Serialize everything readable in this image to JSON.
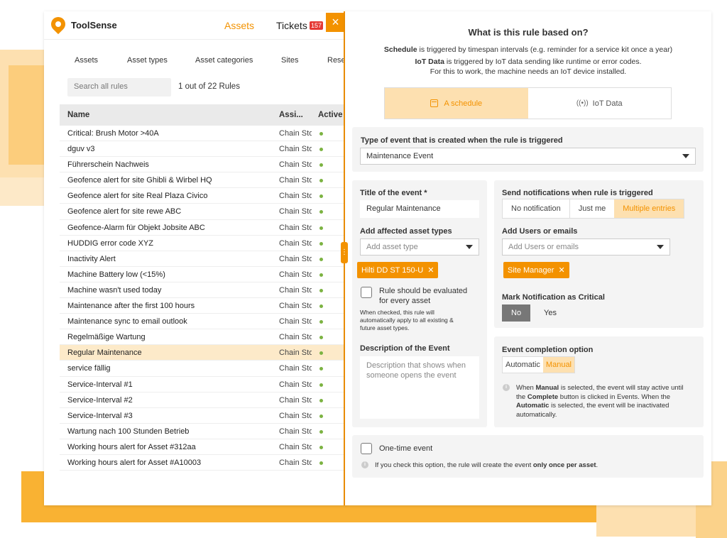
{
  "brand": "ToolSense",
  "nav": {
    "assets": "Assets",
    "tickets": "Tickets",
    "tickets_badge": "157"
  },
  "subnav": [
    "Assets",
    "Asset types",
    "Asset categories",
    "Sites",
    "Rese"
  ],
  "search": {
    "placeholder": "Search all rules",
    "count": "1 out of 22 Rules"
  },
  "table": {
    "headers": [
      "Name",
      "Assi...",
      "Active"
    ],
    "rows": [
      {
        "name": "Critical: Brush Motor >40A",
        "assigned": "Chain Sto"
      },
      {
        "name": "dguv v3",
        "assigned": "Chain Sto"
      },
      {
        "name": "Führerschein Nachweis",
        "assigned": "Chain Sto"
      },
      {
        "name": "Geofence alert for site Ghibli & Wirbel HQ",
        "assigned": "Chain Sto"
      },
      {
        "name": "Geofence alert for site Real Plaza Civico",
        "assigned": "Chain Sto"
      },
      {
        "name": "Geofence alert for site rewe ABC",
        "assigned": "Chain Sto"
      },
      {
        "name": "Geofence-Alarm für Objekt Jobsite ABC",
        "assigned": "Chain Sto"
      },
      {
        "name": "HUDDIG error code XYZ",
        "assigned": "Chain Sto"
      },
      {
        "name": "Inactivity Alert",
        "assigned": "Chain Sto"
      },
      {
        "name": "Machine Battery low (<15%)",
        "assigned": "Chain Sto"
      },
      {
        "name": "Machine wasn't used today",
        "assigned": "Chain Sto"
      },
      {
        "name": "Maintenance after the first 100 hours",
        "assigned": "Chain Sto"
      },
      {
        "name": "Maintenance sync to email outlook",
        "assigned": "Chain Sto"
      },
      {
        "name": "Regelmäßige Wartung",
        "assigned": "Chain Sto"
      },
      {
        "name": "Regular Maintenance",
        "assigned": "Chain Sto"
      },
      {
        "name": "service fällig",
        "assigned": "Chain Sto"
      },
      {
        "name": "Service-Interval #1",
        "assigned": "Chain Sto"
      },
      {
        "name": "Service-Interval #2",
        "assigned": "Chain Sto"
      },
      {
        "name": "Service-Interval #3",
        "assigned": "Chain Sto"
      },
      {
        "name": "Wartung nach 100 Stunden Betrieb",
        "assigned": "Chain Sto"
      },
      {
        "name": "Working hours alert for Asset #312aa",
        "assigned": "Chain Sto"
      },
      {
        "name": "Working hours alert for Asset #A10003",
        "assigned": "Chain Sto"
      }
    ],
    "selected_index": 14
  },
  "close_icon": "×",
  "panel": {
    "title": "What is this rule based on?",
    "schedule_bold": "Schedule",
    "schedule_rest": " is triggered by timespan intervals (e.g. reminder for a service kit once a year)",
    "iot_bold": "IoT Data",
    "iot_rest": " is triggered by IoT data sending like runtime or error codes.",
    "iot_note": "For this to work, the machine needs an IoT device installed.",
    "toggle": {
      "schedule": "A schedule",
      "iot": "IoT Data"
    },
    "event_type": {
      "label": "Type of event that is created when the rule is triggered",
      "value": "Maintenance Event"
    },
    "title_field": {
      "label": "Title of the event *",
      "value": "Regular Maintenance"
    },
    "asset_types": {
      "label": "Add affected asset types",
      "placeholder": "Add asset type",
      "chip": "Hilti DD ST 150-U"
    },
    "evaluate": {
      "label_line1": "Rule should be evaluated",
      "label_line2": "for every asset",
      "help_line1": "When checked, this rule will",
      "help_line2": "automatically apply to all existing &",
      "help_line3": "future asset types."
    },
    "description": {
      "label": "Description of the Event",
      "placeholder_line1": "Description that shows when",
      "placeholder_line2": "someone opens the event"
    },
    "notifications": {
      "label": "Send notifications when rule is triggered",
      "options": [
        "No notification",
        "Just me",
        "Multiple entries"
      ],
      "selected": "Multiple entries"
    },
    "users": {
      "label": "Add Users or emails",
      "placeholder": "Add Users or emails",
      "chip": "Site Manager"
    },
    "critical": {
      "label": "Mark Notification as Critical",
      "no": "No",
      "yes": "Yes"
    },
    "completion": {
      "label": "Event completion option",
      "automatic": "Automatic",
      "manual": "Manual",
      "info_l1_a": "When ",
      "info_l1_b": "Manual",
      "info_l1_c": " is selected, the event will stay active until",
      "info_l2_a": "the ",
      "info_l2_b": "Complete",
      "info_l2_c": " button is clicked in Events. When the",
      "info_l3_a": "",
      "info_l3_b": "Automatic",
      "info_l3_c": " is selected, the event will be inactivated",
      "info_l4": "automatically."
    },
    "one_time": {
      "label": "One-time event",
      "info_a": "If you check this option, the rule will create the event ",
      "info_b": "only once per asset",
      "info_c": "."
    }
  },
  "colors": {
    "accent": "#f39200",
    "accent_light": "#fde0b0",
    "active_dot": "#7cb342",
    "badge": "#e53935"
  }
}
